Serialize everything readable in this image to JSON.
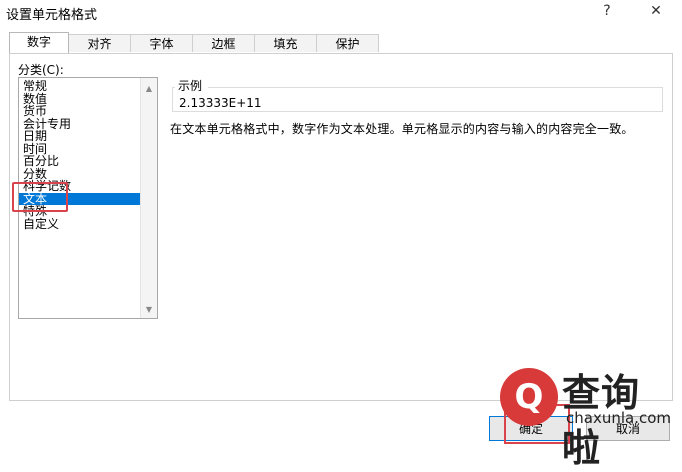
{
  "dialog": {
    "title": "设置单元格格式",
    "help": "?",
    "close": "✕"
  },
  "tabs": [
    "数字",
    "对齐",
    "字体",
    "边框",
    "填充",
    "保护"
  ],
  "category": {
    "label": "分类(C):",
    "items": [
      "常规",
      "数值",
      "货币",
      "会计专用",
      "日期",
      "时间",
      "百分比",
      "分数",
      "科学记数",
      "文本",
      "特殊",
      "自定义"
    ],
    "selected": "文本"
  },
  "sample": {
    "legend": "示例",
    "value": "2.13333E+11"
  },
  "description": "在文本单元格格式中，数字作为文本处理。单元格显示的内容与输入的内容完全一致。",
  "buttons": {
    "ok": "确定",
    "cancel": "取消"
  },
  "watermark": {
    "name": "查询啦",
    "url": "chaxunla.com"
  },
  "colors": {
    "selection": "#0078d7",
    "highlight": "#d9434b"
  }
}
